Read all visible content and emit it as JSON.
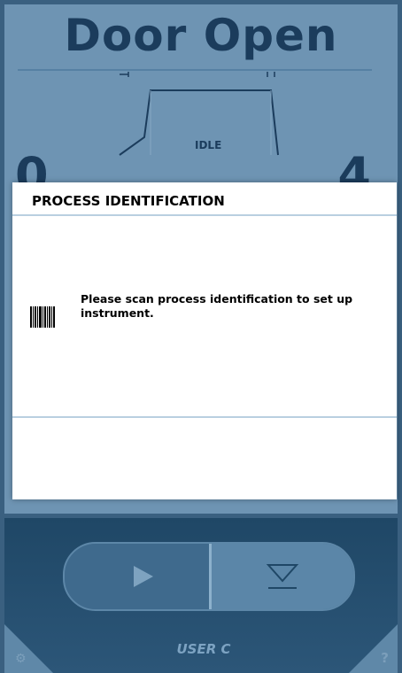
{
  "status": {
    "title": "Door Open",
    "phase": "IDLE",
    "left_value": "0",
    "right_value": "4"
  },
  "dialog": {
    "title": "PROCESS IDENTIFICATION",
    "message": "Please scan process identification to set up instrument.",
    "icon": "barcode-icon"
  },
  "controls": {
    "play_icon": "play-icon",
    "unload_icon": "eject-down-icon",
    "user_label": "USER C",
    "settings_icon": "gear-icon",
    "help_icon": "help-icon",
    "help_glyph": "?"
  },
  "colors": {
    "background": "#6e94b3",
    "panel": "#1f4766",
    "dialog": "#ffffff",
    "text_dark": "#1b3c5c"
  }
}
